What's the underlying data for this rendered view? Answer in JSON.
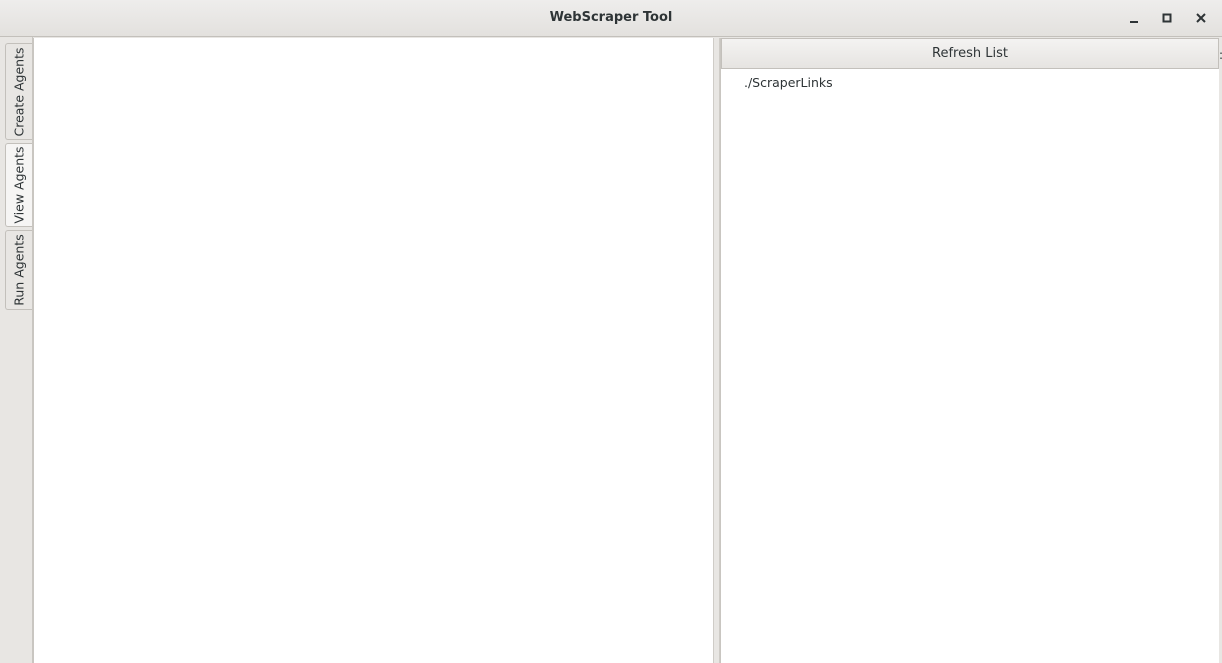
{
  "window": {
    "title": "WebScraper Tool",
    "controls": [
      "minimize",
      "maximize",
      "close"
    ]
  },
  "tabs": [
    {
      "label": "Create Agents",
      "active": false
    },
    {
      "label": "View Agents",
      "active": true
    },
    {
      "label": "Run Agents",
      "active": false
    }
  ],
  "right_panel": {
    "refresh_label": "Refresh List",
    "items": [
      "./ScraperLinks"
    ]
  }
}
